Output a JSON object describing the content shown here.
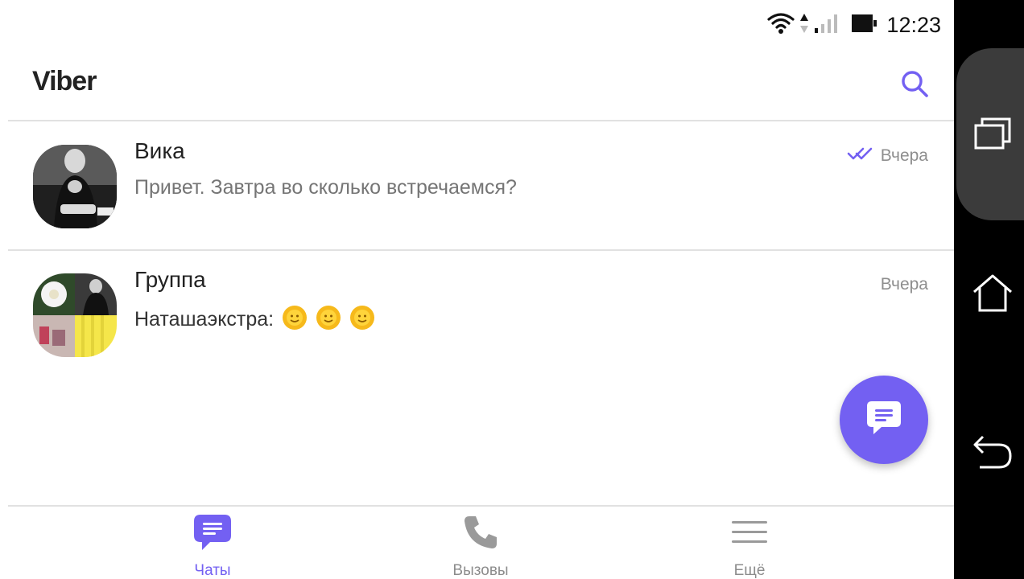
{
  "status_bar": {
    "time": "12:23",
    "icons": [
      "wifi-icon",
      "data-arrows-icon",
      "signal-icon",
      "battery-icon"
    ]
  },
  "app_bar": {
    "title": "Viber",
    "search_icon": "search-icon"
  },
  "chats": [
    {
      "name": "Вика",
      "message": "Привет. Завтра во сколько встречаемся?",
      "time": "Вчера",
      "read_status": "double-check-icon"
    },
    {
      "name": "Группа",
      "message": "Наташаэкстра:",
      "emoji": [
        "sun-face-emoji",
        "sun-face-emoji",
        "sun-face-emoji"
      ],
      "time": "Вчера"
    }
  ],
  "fab": {
    "icon": "new-chat-icon"
  },
  "bottom_nav": {
    "tabs": [
      {
        "label": "Чаты",
        "icon": "chats-icon",
        "active": true
      },
      {
        "label": "Вызовы",
        "icon": "phone-icon",
        "active": false
      },
      {
        "label": "Ещё",
        "icon": "menu-icon",
        "active": false
      }
    ]
  },
  "system_nav": [
    "recent-apps-icon",
    "home-icon",
    "back-icon"
  ],
  "colors": {
    "accent": "#7360f2",
    "text_primary": "#222222",
    "text_secondary": "#757575",
    "divider": "#e1e1e1",
    "nav_bar": "#000000"
  }
}
